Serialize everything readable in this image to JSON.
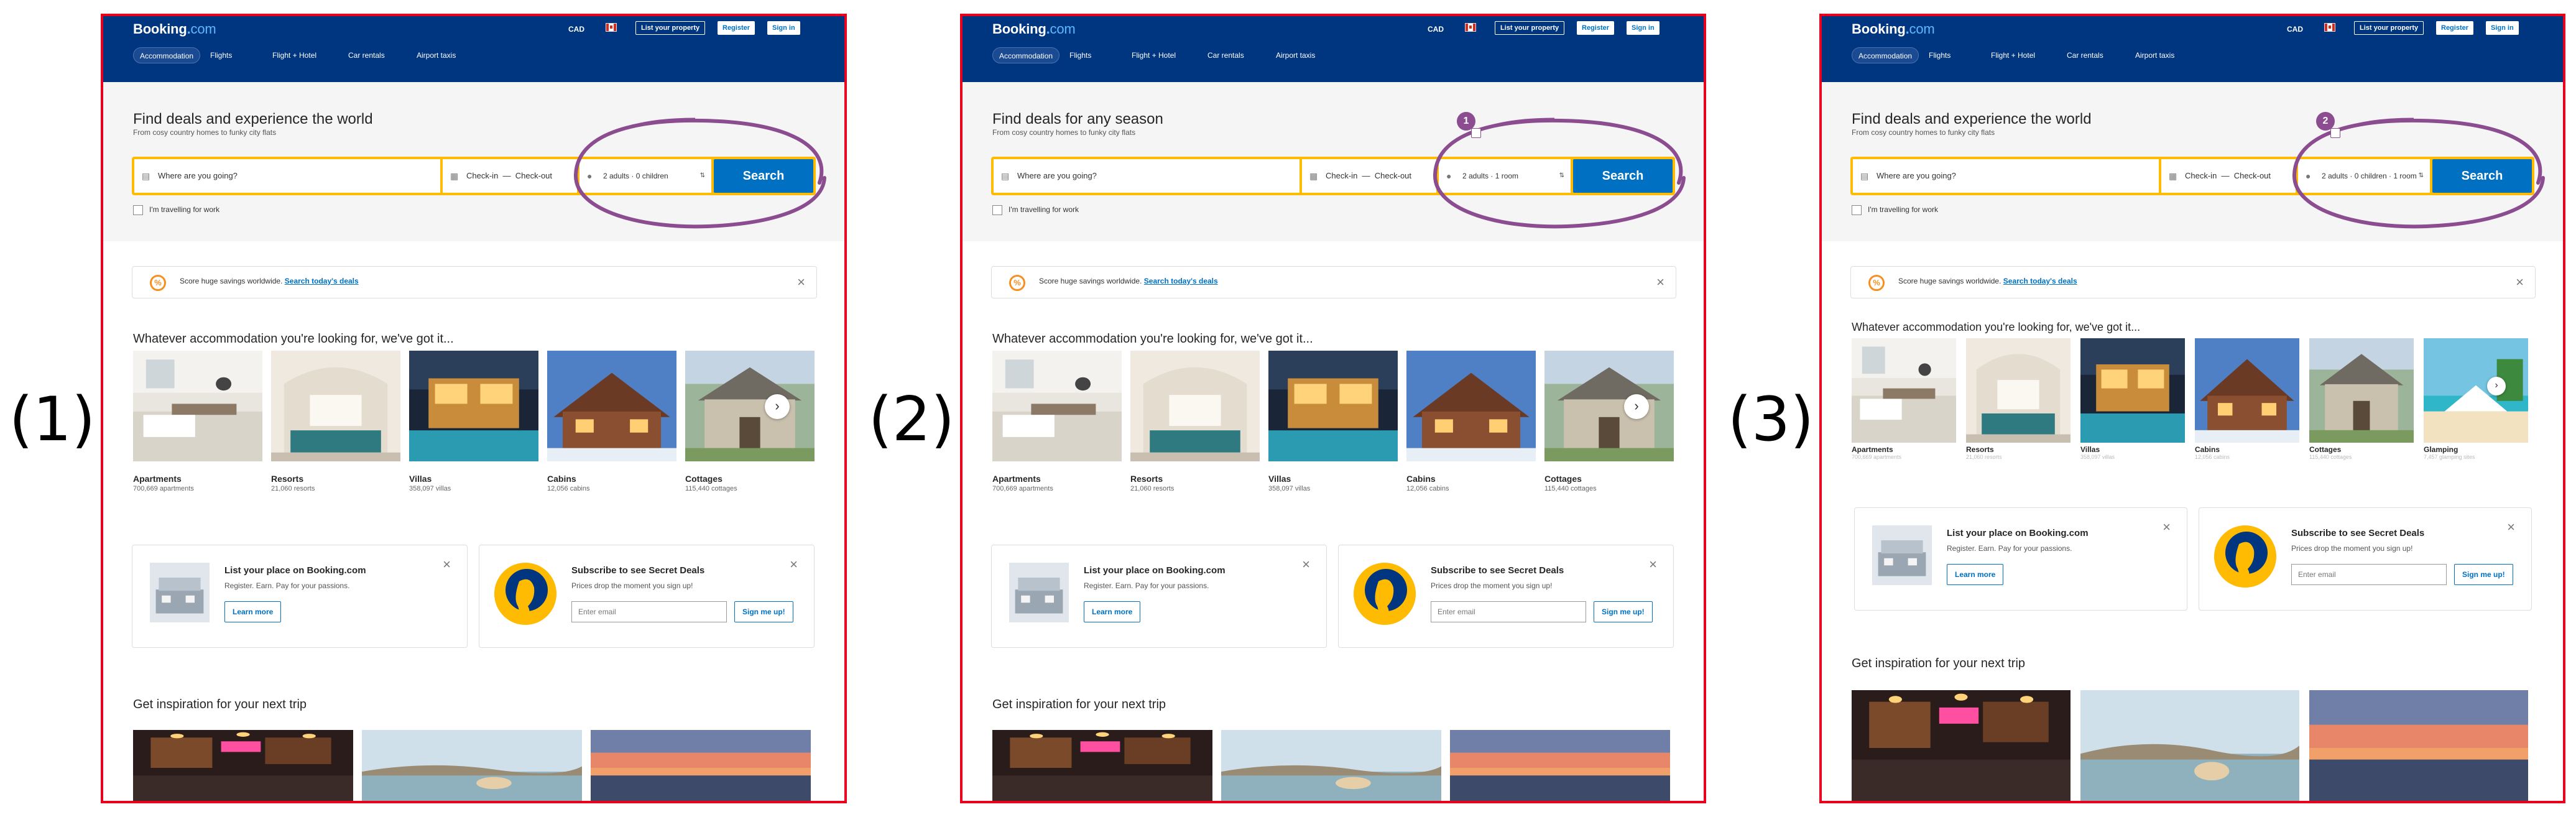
{
  "labels": {
    "p1": "(1)",
    "p2": "(2)",
    "p3": "(3)"
  },
  "brand": {
    "name": "Booking",
    "dot": ".",
    "tld": "com"
  },
  "colors": {
    "header": "#003580",
    "accent": "#0071c2",
    "searchbar": "#febb02",
    "frame": "#e8001c",
    "annotation": "#8b4c90",
    "promo_icon": "#f78e1e"
  },
  "header": {
    "currency": "CAD",
    "flag_icon": "canada-flag-icon",
    "list_property": "List your property",
    "register": "Register",
    "sign_in": "Sign in",
    "nav": [
      "Accommodation",
      "Flights",
      "Flight + Hotel",
      "Car rentals",
      "Airport taxis"
    ]
  },
  "panels": [
    {
      "headline": "Find deals and experience the world",
      "subline": "From cosy country homes to funky city flats",
      "destination_placeholder": "Where are you going?",
      "check_in": "Check-in",
      "dash": "—",
      "check_out": "Check-out",
      "guests": "2 adults · 0 children",
      "search": "Search",
      "badge": ""
    },
    {
      "headline": "Find deals for any season",
      "subline": "From cosy country homes to funky city flats",
      "destination_placeholder": "Where are you going?",
      "check_in": "Check-in",
      "dash": "—",
      "check_out": "Check-out",
      "guests": "2 adults · 1 room",
      "search": "Search",
      "badge": "1"
    },
    {
      "headline": "Find deals and experience the world",
      "subline": "From cosy country homes to funky city flats",
      "destination_placeholder": "Where are you going?",
      "check_in": "Check-in",
      "dash": "—",
      "check_out": "Check-out",
      "guests": "2 adults · 0 children · 1 room",
      "search": "Search",
      "badge": "2"
    }
  ],
  "business_travel": "I'm travelling for work",
  "promo": {
    "text": "Score huge savings worldwide.",
    "link": "Search today's deals",
    "icon": "savings-badge-icon"
  },
  "accommodation": {
    "heading": "Whatever accommodation you're looking for, we've got it...",
    "items": [
      {
        "name": "Apartments",
        "count": "700,669 apartments"
      },
      {
        "name": "Resorts",
        "count": "21,060 resorts"
      },
      {
        "name": "Villas",
        "count": "358,097 villas"
      },
      {
        "name": "Cabins",
        "count": "12,056 cabins"
      },
      {
        "name": "Cottages",
        "count": "115,440 cottages"
      },
      {
        "name": "Glamping",
        "count": "7,457 glamping sites"
      }
    ]
  },
  "list_place": {
    "title": "List your place on Booking.com",
    "text": "Register. Earn. Pay for your passions.",
    "button": "Learn more"
  },
  "secret_deals": {
    "title": "Subscribe to see Secret Deals",
    "text": "Prices drop the moment you sign up!",
    "email_placeholder": "Enter email",
    "button": "Sign me up!"
  },
  "inspiration": {
    "heading": "Get inspiration for your next trip"
  }
}
